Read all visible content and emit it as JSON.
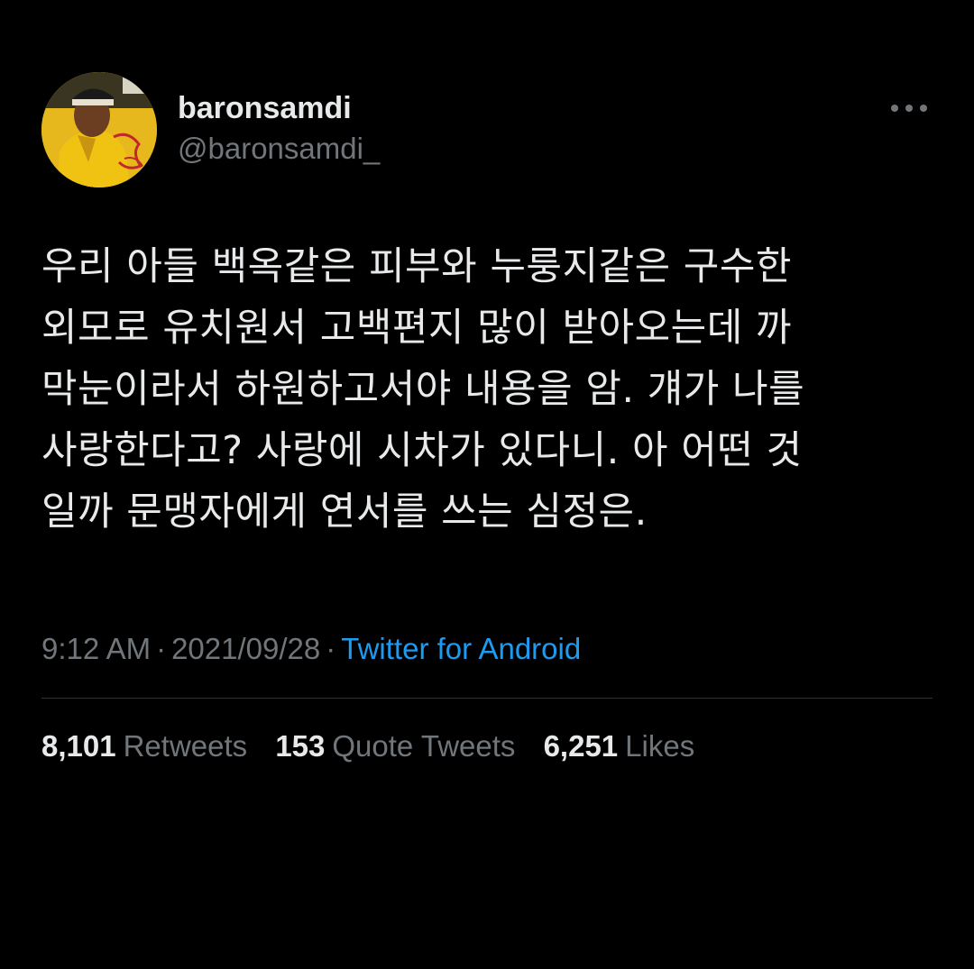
{
  "user": {
    "display_name": "baronsamdi",
    "handle": "@baronsamdi_"
  },
  "more_icon": "more-horizontal-icon",
  "tweet": {
    "text": "우리 아들 백옥같은 피부와 누룽지같은 구수한\n외모로 유치원서 고백편지 많이 받아오는데 까\n막눈이라서 하원하고서야 내용을 암. 걔가 나를\n사랑한다고? 사랑에 시차가 있다니. 아 어떤 것\n일까 문맹자에게 연서를 쓰는 심정은.",
    "time": "9:12 AM",
    "date": "2021/09/28",
    "separator": "·",
    "source": "Twitter for Android"
  },
  "stats": {
    "retweets_count": "8,101",
    "retweets_label": "Retweets",
    "quotes_count": "153",
    "quotes_label": "Quote Tweets",
    "likes_count": "6,251",
    "likes_label": "Likes"
  },
  "colors": {
    "background": "#000000",
    "primary_text": "#e7e9ea",
    "secondary_text": "#71767b",
    "link": "#1d9bf0",
    "divider": "#2f3336"
  }
}
